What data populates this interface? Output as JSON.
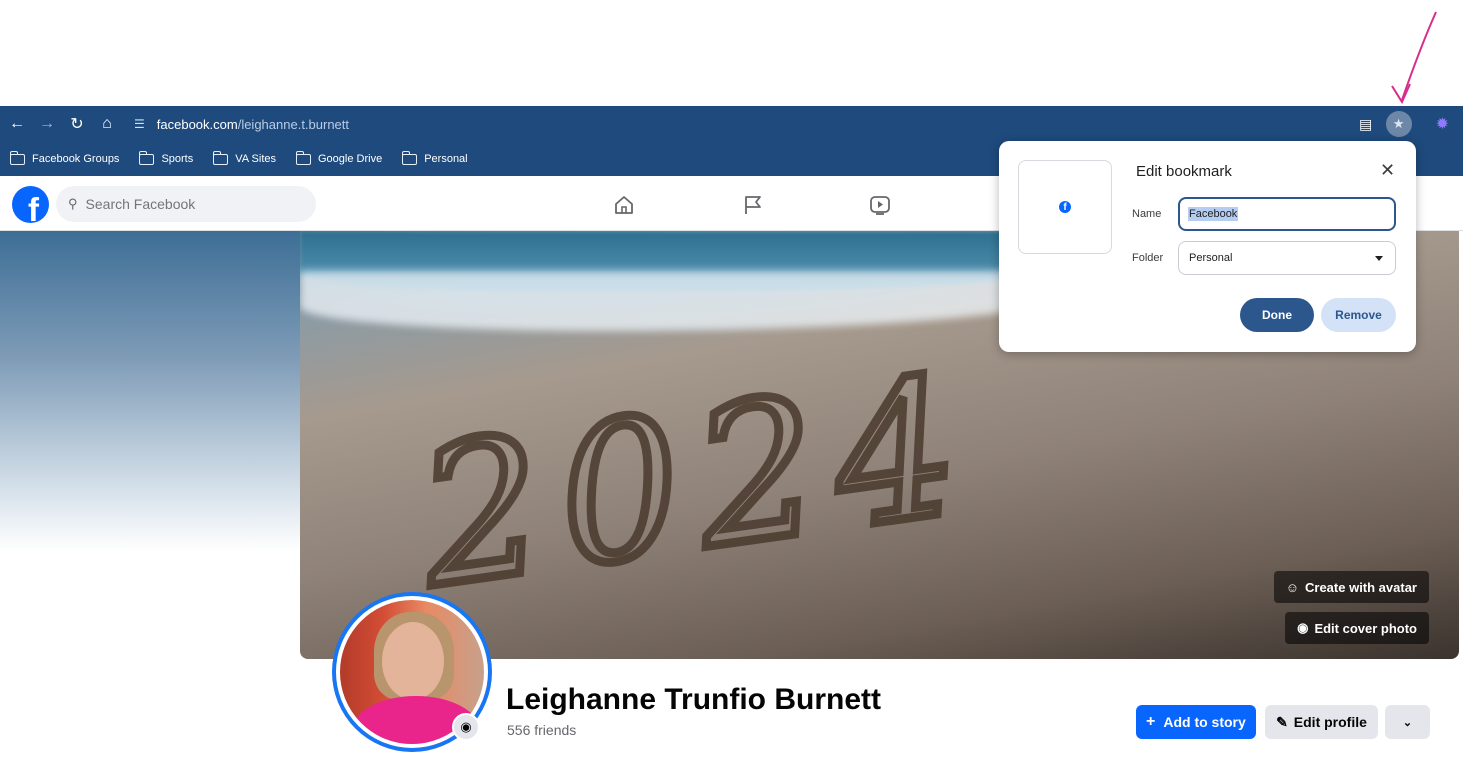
{
  "browser": {
    "url_host": "facebook.com",
    "url_path": "/leighanne.t.burnett",
    "nav_icons": [
      "back-arrow-icon",
      "forward-arrow-icon",
      "reload-icon",
      "home-icon",
      "site-info-icon"
    ],
    "right_icons": [
      "install-app-icon",
      "bookmark-star-icon",
      "extension-icon"
    ]
  },
  "bookmarks_bar": {
    "items": [
      {
        "label": "Facebook Groups",
        "icon": "folder-icon"
      },
      {
        "label": "Sports",
        "icon": "folder-icon"
      },
      {
        "label": "VA Sites",
        "icon": "folder-icon"
      },
      {
        "label": "Google Drive",
        "icon": "folder-icon"
      },
      {
        "label": "Personal",
        "icon": "folder-icon"
      }
    ]
  },
  "facebook_header": {
    "logo": "f",
    "search_placeholder": "Search Facebook",
    "nav_icons": [
      "home-icon",
      "pages-flag-icon",
      "video-icon"
    ]
  },
  "cover": {
    "sand_text": "2024",
    "create_avatar_label": "Create with avatar",
    "edit_cover_label": "Edit cover photo"
  },
  "profile": {
    "name": "Leighanne Trunfio Burnett",
    "friends": "556 friends",
    "add_story_label": "Add to story",
    "edit_profile_label": "Edit profile"
  },
  "bookmark_dialog": {
    "title": "Edit bookmark",
    "name_label": "Name",
    "name_value": "Facebook",
    "folder_label": "Folder",
    "folder_value": "Personal",
    "done_label": "Done",
    "remove_label": "Remove"
  },
  "colors": {
    "browser_chrome": "#1e4a7d",
    "facebook_blue": "#0866ff",
    "dialog_accent": "#2c578c",
    "annotation_arrow": "#d62e8c"
  }
}
